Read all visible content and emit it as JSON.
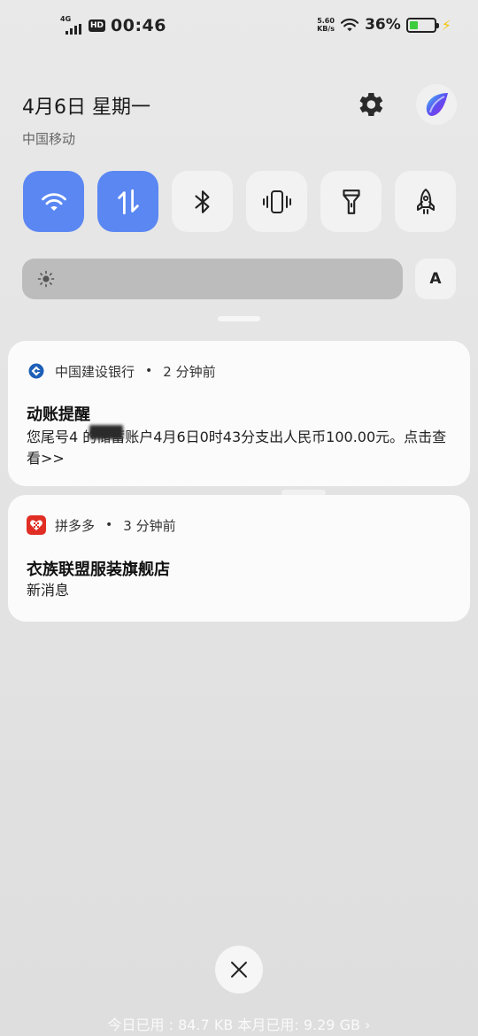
{
  "status_bar": {
    "network": "4G",
    "hd": "HD",
    "time": "00:46",
    "speed_value": "5.60",
    "speed_unit": "KB/s",
    "battery_percent": "36%",
    "battery_level": 0.36,
    "battery_color": "#3ccd3c",
    "charging_icon": "lightning-bolt-icon"
  },
  "header": {
    "date": "4月6日 星期一",
    "carrier": "中国移动",
    "settings_icon": "gear-icon",
    "account_icon": "avatar-icon"
  },
  "quick_tiles": [
    {
      "name": "wifi",
      "icon": "wifi-icon",
      "active": true
    },
    {
      "name": "mobile-data",
      "icon": "data-transfer-icon",
      "active": true
    },
    {
      "name": "bluetooth",
      "icon": "bluetooth-icon",
      "active": false
    },
    {
      "name": "vibrate",
      "icon": "vibrate-icon",
      "active": false
    },
    {
      "name": "flashlight",
      "icon": "flashlight-icon",
      "active": false
    },
    {
      "name": "rocket",
      "icon": "rocket-icon",
      "active": false
    }
  ],
  "accent_color": "#5b87f3",
  "brightness": {
    "level": 0.0,
    "auto_label": "A"
  },
  "notifications": [
    {
      "app": "中国建设银行",
      "time": "2 分钟前",
      "title": "动账提醒",
      "body": "您尾号4   的储蓄账户4月6日0时43分支出人民币100.00元。点击查看>>",
      "icon": "ccb-bank-icon",
      "icon_color": "#1d5fb7"
    },
    {
      "app": "拼多多",
      "time": "3 分钟前",
      "title": "衣族联盟服装旗舰店",
      "body": "新消息",
      "icon": "pinduoduo-icon",
      "icon_color": "#e02e24"
    }
  ],
  "bottom": {
    "close_icon": "close-icon",
    "usage_text": "今日已用 : 84.7 KB 本月已用: 9.29 GB ›"
  }
}
